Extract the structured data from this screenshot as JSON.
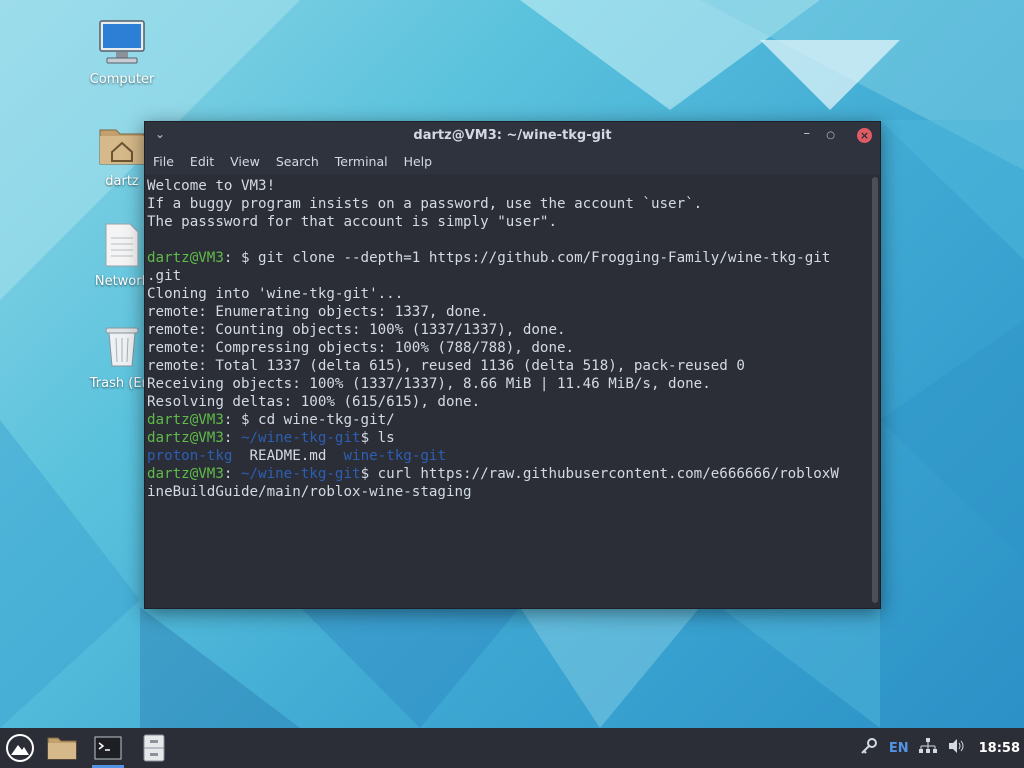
{
  "desktop": {
    "icons": [
      {
        "label": "Computer"
      },
      {
        "label": "dartz"
      },
      {
        "label": "Network"
      },
      {
        "label": "Trash (Em"
      }
    ]
  },
  "window": {
    "title": "dartz@VM3: ~/wine-tkg-git",
    "menu": [
      "File",
      "Edit",
      "View",
      "Search",
      "Terminal",
      "Help"
    ]
  },
  "terminal": {
    "welcome": [
      "Welcome to VM3!",
      "If a buggy program insists on a password, use the account `user`.",
      "The passsword for that account is simply \"user\"."
    ],
    "prompt_user": "dartz@VM3",
    "cmd1": "$ git clone --depth=1 https://github.com/Frogging-Family/wine-tkg-git",
    "cmd1_wrap": ".git",
    "clone_output": [
      "Cloning into 'wine-tkg-git'...",
      "remote: Enumerating objects: 1337, done.",
      "remote: Counting objects: 100% (1337/1337), done.",
      "remote: Compressing objects: 100% (788/788), done.",
      "remote: Total 1337 (delta 615), reused 1136 (delta 518), pack-reused 0",
      "Receiving objects: 100% (1337/1337), 8.66 MiB | 11.46 MiB/s, done.",
      "Resolving deltas: 100% (615/615), done."
    ],
    "cmd2": "$ cd wine-tkg-git/",
    "cwd": "~/wine-tkg-git",
    "cmd3": "$ ls",
    "ls_dir1": "proton-tkg",
    "ls_file": "README.md",
    "ls_dir2": "wine-tkg-git",
    "cmd4": "$ curl https://raw.githubusercontent.com/e666666/robloxW",
    "cmd4_wrap": "ineBuildGuide/main/roblox-wine-staging"
  },
  "panel": {
    "lang": "EN",
    "clock": "18:58"
  },
  "colors": {
    "prompt_green": "#5fbb48",
    "dir_blue": "#2c5fb3",
    "accent": "#5294e2"
  }
}
